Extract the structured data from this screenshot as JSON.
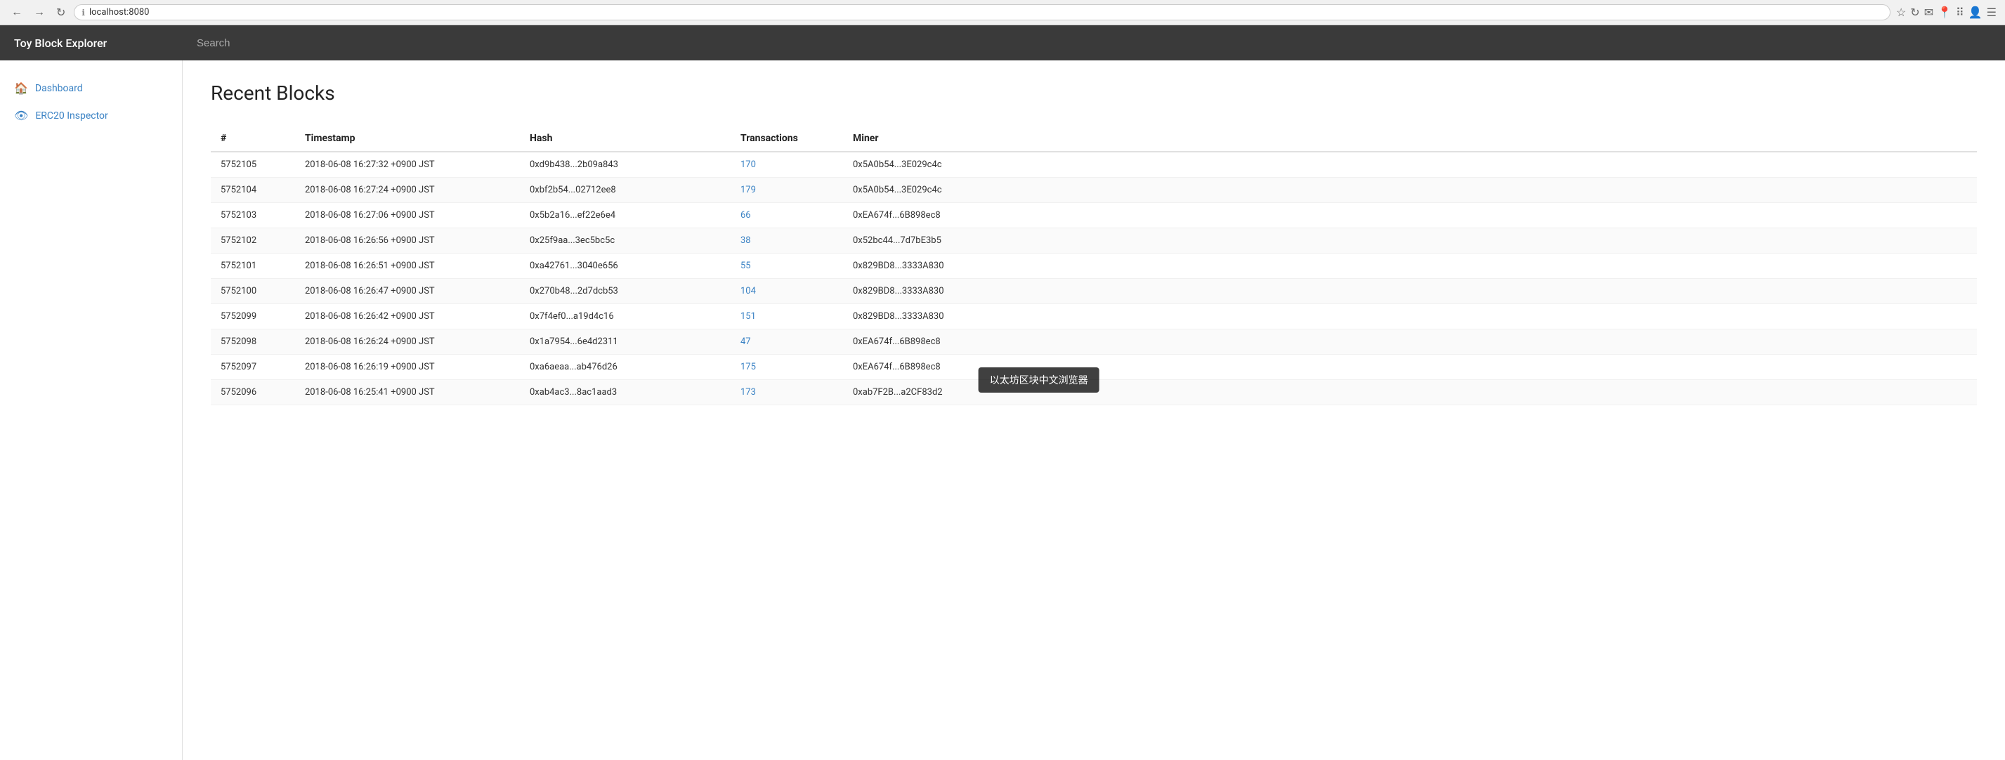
{
  "browser": {
    "url": "localhost:8080",
    "url_icon": "ℹ",
    "back_label": "←",
    "forward_label": "→",
    "reload_label": "↻"
  },
  "app": {
    "title": "Toy Block Explorer",
    "search_placeholder": "Search"
  },
  "sidebar": {
    "items": [
      {
        "id": "dashboard",
        "label": "Dashboard",
        "icon": "🏠"
      },
      {
        "id": "erc20",
        "label": "ERC20 Inspector",
        "icon": "👁"
      }
    ]
  },
  "main": {
    "page_title": "Recent Blocks",
    "table": {
      "columns": [
        "#",
        "Timestamp",
        "Hash",
        "Transactions",
        "Miner"
      ],
      "rows": [
        {
          "number": "5752105",
          "timestamp": "2018-06-08 16:27:32 +0900 JST",
          "hash": "0xd9b438...2b09a843",
          "transactions": "170",
          "miner": "0x5A0b54...3E029c4c"
        },
        {
          "number": "5752104",
          "timestamp": "2018-06-08 16:27:24 +0900 JST",
          "hash": "0xbf2b54...02712ee8",
          "transactions": "179",
          "miner": "0x5A0b54...3E029c4c"
        },
        {
          "number": "5752103",
          "timestamp": "2018-06-08 16:27:06 +0900 JST",
          "hash": "0x5b2a16...ef22e6e4",
          "transactions": "66",
          "miner": "0xEA674f...6B898ec8"
        },
        {
          "number": "5752102",
          "timestamp": "2018-06-08 16:26:56 +0900 JST",
          "hash": "0x25f9aa...3ec5bc5c",
          "transactions": "38",
          "miner": "0x52bc44...7d7bE3b5"
        },
        {
          "number": "5752101",
          "timestamp": "2018-06-08 16:26:51 +0900 JST",
          "hash": "0xa42761...3040e656",
          "transactions": "55",
          "miner": "0x829BD8...3333A830"
        },
        {
          "number": "5752100",
          "timestamp": "2018-06-08 16:26:47 +0900 JST",
          "hash": "0x270b48...2d7dcb53",
          "transactions": "104",
          "miner": "0x829BD8...3333A830"
        },
        {
          "number": "5752099",
          "timestamp": "2018-06-08 16:26:42 +0900 JST",
          "hash": "0x7f4ef0...a19d4c16",
          "transactions": "151",
          "miner": "0x829BD8...3333A830"
        },
        {
          "number": "5752098",
          "timestamp": "2018-06-08 16:26:24 +0900 JST",
          "hash": "0x1a7954...6e4d2311",
          "transactions": "47",
          "miner": "0xEA674f...6B898ec8"
        },
        {
          "number": "5752097",
          "timestamp": "2018-06-08 16:26:19 +0900 JST",
          "hash": "0xa6aeaa...ab476d26",
          "transactions": "175",
          "miner": "0xEA674f...6B898ec8"
        },
        {
          "number": "5752096",
          "timestamp": "2018-06-08 16:25:41 +0900 JST",
          "hash": "0xab4ac3...8ac1aad3",
          "transactions": "173",
          "miner": "0xab7F2B...a2CF83d2"
        }
      ]
    }
  },
  "tooltip": {
    "text": "以太坊区块中文浏览器"
  }
}
